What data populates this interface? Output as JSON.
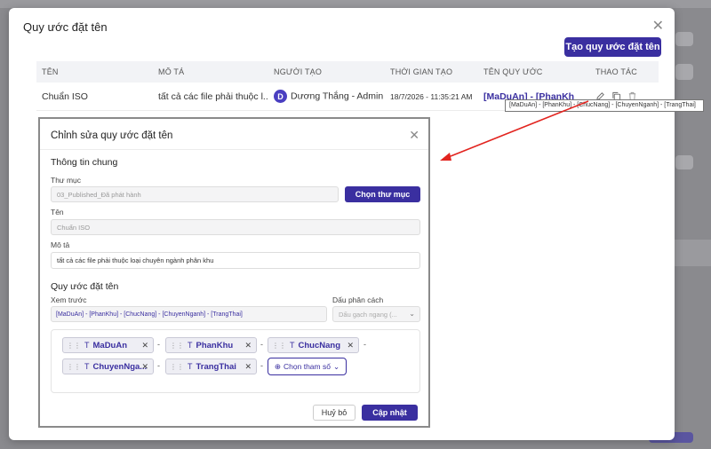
{
  "outer_modal": {
    "title": "Quy ước đặt tên",
    "create_button": "Tạo quy ước đặt tên",
    "table": {
      "headers": [
        "TÊN",
        "MÔ TẢ",
        "NGƯỜI TẠO",
        "THỜI GIAN TẠO",
        "TÊN QUY ƯỚC",
        "THAO TÁC"
      ],
      "rows": [
        {
          "name": "Chuẩn ISO",
          "description": "tất cả các file phải thuộc l...",
          "creator_initial": "D",
          "creator": "Dương Thắng - Admin",
          "created_at": "18/7/2026 - 11:35:21 AM",
          "convention": "[MaDuAn] - [PhanKhu] -"
        }
      ]
    },
    "tooltip": "[MaDuAn] - [PhanKhu] - [ChucNang] - [ChuyenNganh] - [TrangThai]"
  },
  "edit_dialog": {
    "title": "Chỉnh sửa quy ước đặt tên",
    "general_section": "Thông tin chung",
    "folder_label": "Thư mục",
    "folder_value": "03_Published_Đã phát hành",
    "folder_button": "Chọn thư mục",
    "name_label": "Tên",
    "name_value": "Chuẩn ISO",
    "desc_label": "Mô tả",
    "desc_value": "tất cả các file phải thuộc loại chuyên ngành phân khu",
    "naming_section": "Quy ước đặt tên",
    "preview_label": "Xem trước",
    "preview_value": "[MaDuAn] - [PhanKhu] - [ChucNang] - [ChuyenNganh] - [TrangThai]",
    "separator_label": "Dấu phân cách",
    "separator_value": "Dấu gạch ngang (...",
    "tokens": [
      "MaDuAn",
      "PhanKhu",
      "ChucNang",
      "ChuyenNga...",
      "TrangThai"
    ],
    "token_separator": "-",
    "add_param": "Chọn tham số",
    "cancel": "Huỷ bỏ",
    "update": "Cập nhật"
  }
}
